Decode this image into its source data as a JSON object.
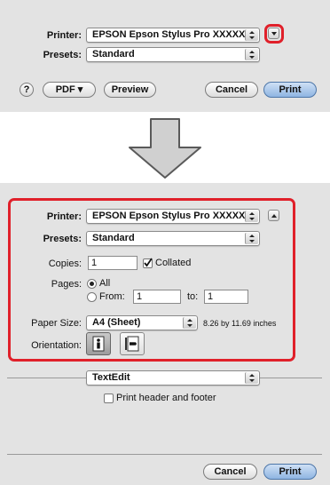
{
  "top": {
    "printer_label": "Printer:",
    "printer_value": "EPSON Epson Stylus Pro XXXXX",
    "presets_label": "Presets:",
    "presets_value": "Standard",
    "help_symbol": "?",
    "pdf_label": "PDF ▾",
    "preview_label": "Preview",
    "cancel_label": "Cancel",
    "print_label": "Print"
  },
  "bottom": {
    "printer_label": "Printer:",
    "printer_value": "EPSON Epson Stylus Pro XXXXX",
    "presets_label": "Presets:",
    "presets_value": "Standard",
    "copies_label": "Copies:",
    "copies_value": "1",
    "collated_label": "Collated",
    "collated_checked": true,
    "pages_label": "Pages:",
    "pages_all_label": "All",
    "pages_from_label": "From:",
    "pages_from_value": "1",
    "pages_to_label": "to:",
    "pages_to_value": "1",
    "paper_size_label": "Paper Size:",
    "paper_size_value": "A4 (Sheet)",
    "paper_dimensions": "8.26 by 11.69 inches",
    "orientation_label": "Orientation:",
    "app_menu_value": "TextEdit",
    "header_footer_label": "Print header and footer",
    "cancel_label": "Cancel",
    "print_label": "Print"
  },
  "colors": {
    "highlight_red": "#e0202a",
    "panel_gray": "#e3e3e3",
    "arrow_gray": "#d0d0d0"
  }
}
